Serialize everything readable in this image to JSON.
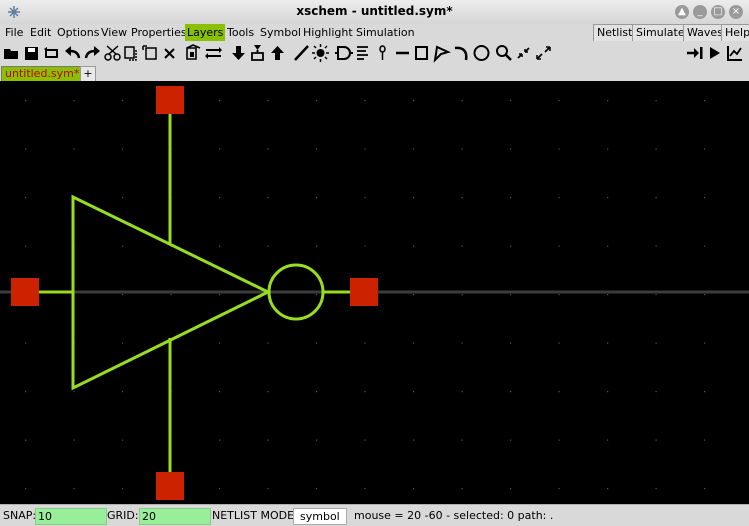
{
  "window": {
    "title": "xschem - untitled.sym*"
  },
  "menubar": {
    "items": [
      "File",
      "Edit",
      "Options",
      "View",
      "Properties",
      "Layers",
      "Tools",
      "Symbol",
      "Highlight",
      "Simulation"
    ],
    "active": "Layers",
    "right_items": [
      "Netlist",
      "Simulate",
      "Waves",
      "Help"
    ]
  },
  "toolbar": {
    "icons": [
      "open-icon",
      "save-icon",
      "reload-icon",
      "undo-icon",
      "redo-icon",
      "cut-icon",
      "copy-icon",
      "duplicate-icon",
      "delete-icon",
      "symbol-icon",
      "swap-icon",
      "push-down-icon",
      "pin-icon",
      "push-up-icon",
      "wire-icon",
      "bulb-icon",
      "gate-icon",
      "text-icon",
      "probe-icon",
      "line-icon",
      "rect-icon",
      "poly-icon",
      "arc-icon",
      "circle-icon",
      "zoom-icon",
      "zoom-out-icon",
      "zoom-in-icon",
      "netlist-icon",
      "simulate-icon",
      "waves-icon"
    ]
  },
  "tabs": {
    "active_label": "untitled.sym*",
    "add_label": "+"
  },
  "status": {
    "snap_label": "SNAP:",
    "snap_value": "10",
    "grid_label": "GRID:",
    "grid_value": "20",
    "mode_label": "NETLIST MODE:",
    "mode_value": "symbol",
    "info": "mouse = 20 -60 - selected: 0 path: ."
  },
  "colors": {
    "accent": "#8ac000",
    "symbol_line": "#99dd22",
    "pin": "#cc2200",
    "wire": "#3c3c3c",
    "canvas": "#000000"
  }
}
